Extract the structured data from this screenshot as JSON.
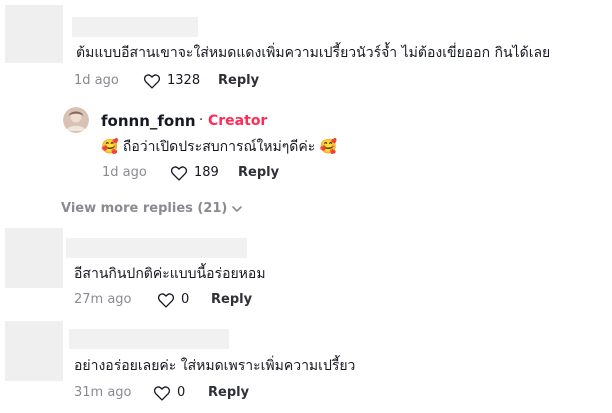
{
  "comments": [
    {
      "text": "ต้มแบบอีสานเขาจะใส่หมดแดงเพิ่มความเปรี้ยวนัวร์จ้ำ ไม่ต้องเขี่ยออก กินได้เลย",
      "time": "1d ago",
      "likes": "1328",
      "reply_label": "Reply",
      "like_icon": "heart-outline-icon"
    },
    {
      "text": "อีสานกินปกติค่ะแบบนี้อร่อยหอม",
      "time": "27m ago",
      "likes": "0",
      "reply_label": "Reply",
      "like_icon": "heart-outline-icon"
    },
    {
      "text": "อย่างอร่อยเลยค่ะ ใส่หมดเพราะเพิ่มความเปรี้ยว",
      "time": "31m ago",
      "likes": "0",
      "reply_label": "Reply",
      "like_icon": "heart-outline-icon"
    }
  ],
  "creator_reply": {
    "username": "fonnn_fonn",
    "separator": "·",
    "creator_label": "Creator",
    "emoji_left": "🥰",
    "text": "ถือว่าเปิดประสบการณ์ใหม่ๆดีค่ะ",
    "emoji_right": "🥰",
    "time": "1d ago",
    "likes": "189",
    "reply_label": "Reply",
    "like_icon": "heart-outline-icon"
  },
  "view_more": {
    "label": "View more replies (21)",
    "icon": "chevron-down-icon"
  },
  "colors": {
    "creator_accent": "#fe2c55",
    "meta_gray": "#8a8b91",
    "placeholder_gray": "#efefef"
  }
}
